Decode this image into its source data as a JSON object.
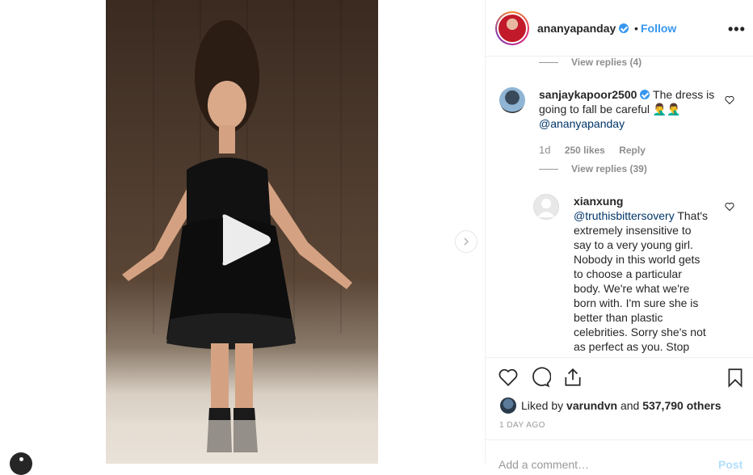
{
  "post": {
    "username": "ananyapanday",
    "separator": "•",
    "follow_label": "Follow",
    "more_label": "•••"
  },
  "comments": {
    "top_view_replies": "View replies (4)",
    "c1": {
      "username": "sanjaykapoor2500",
      "text": "The dress is going to fall be careful 🤦‍♂️🤦‍♂️",
      "mention": "@ananyapanday",
      "age": "1d",
      "likes": "250 likes",
      "reply_label": "Reply",
      "view_replies": "View replies (39)"
    },
    "r1": {
      "username": "xianxung",
      "mention": "@truthisbittersovery",
      "text": "That's extremely insensitive to say to a very young girl. Nobody in this world gets to choose a particular body. We're what we're born with. I'm sure she is better than plastic celebrities. Sorry she's not as perfect as you. Stop"
    }
  },
  "likes": {
    "prefix": "Liked by",
    "user": "varundvn",
    "and": "and",
    "others": "537,790 others"
  },
  "time_ago": "1 DAY AGO",
  "add_comment": {
    "placeholder": "Add a comment…",
    "post_label": "Post"
  }
}
